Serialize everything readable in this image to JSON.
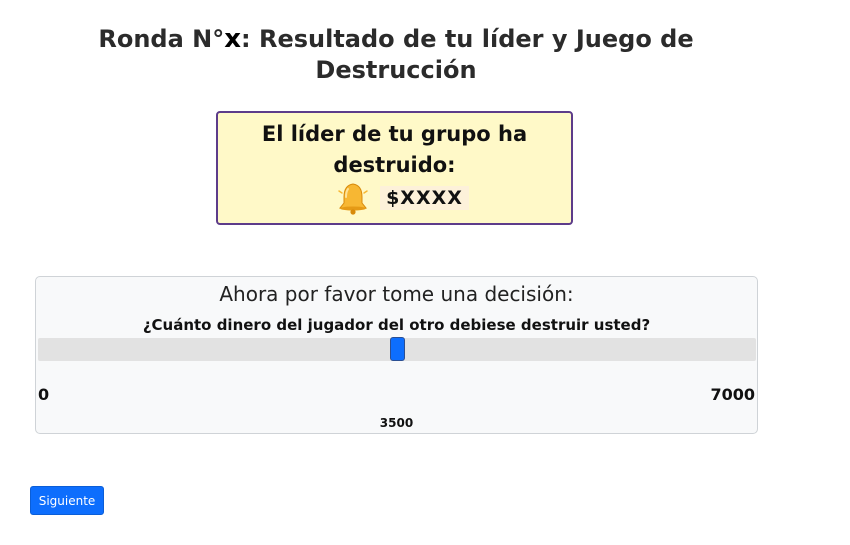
{
  "header": {
    "title_before": "Ronda N°",
    "round_number": "x",
    "title_after": ": Resultado de tu líder y Juego de Destrucción"
  },
  "leader_result": {
    "text": "El líder de tu grupo ha destruido:",
    "icon": "bell-icon",
    "amount": "$XXXX"
  },
  "decision": {
    "heading": "Ahora por favor tome una decisión:",
    "question": "¿Cuánto dinero del jugador del otro debiese destruir usted?",
    "slider": {
      "min": 0,
      "max": 7000,
      "value": 3500,
      "min_label": "0",
      "max_label": "7000",
      "value_label": "3500"
    }
  },
  "actions": {
    "next_label": "Siguiente"
  },
  "colors": {
    "leader_box_background": "#fff9c8",
    "leader_box_border": "#5d3c8a",
    "slider_thumb": "#0d6efd",
    "button_primary": "#0d6efd"
  }
}
